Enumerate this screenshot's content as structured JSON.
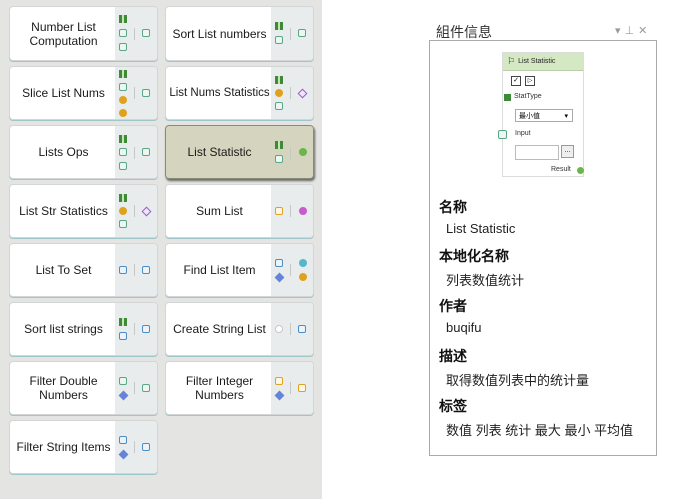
{
  "palette": {
    "nodes": [
      {
        "label": "Number List Computation"
      },
      {
        "label": "Sort List numbers"
      },
      {
        "label": "Slice List Nums"
      },
      {
        "label": "List Nums Statistics"
      },
      {
        "label": "Lists Ops"
      },
      {
        "label": "List Statistic",
        "selected": true
      },
      {
        "label": "List Str Statistics"
      },
      {
        "label": "Sum List"
      },
      {
        "label": "List To Set"
      },
      {
        "label": "Find List Item"
      },
      {
        "label": "Sort list strings"
      },
      {
        "label": "Create String List"
      },
      {
        "label": "Filter Double Numbers"
      },
      {
        "label": "Filter Integer Numbers"
      },
      {
        "label": "Filter String Items"
      }
    ]
  },
  "info_panel": {
    "title": "組件信息",
    "window_icons": [
      "chevron-down-icon",
      "pin-icon",
      "close-icon"
    ],
    "preview": {
      "node_title": "List Statistic",
      "checkbox_label": "▷",
      "stat_type_label": "StatType",
      "stat_type_value": "最小值",
      "input_label": "Input",
      "button_label": "...",
      "result_label": "Result"
    },
    "fields": [
      {
        "heading": "名称",
        "value": "List Statistic"
      },
      {
        "heading": "本地化名称",
        "value": "列表数值统计"
      },
      {
        "heading": "作者",
        "value": "buqifu"
      },
      {
        "heading": "描述",
        "value": "取得数值列表中的统计量"
      },
      {
        "heading": "标签",
        "value": "数值 列表 统计 最大 最小 平均值"
      }
    ]
  }
}
